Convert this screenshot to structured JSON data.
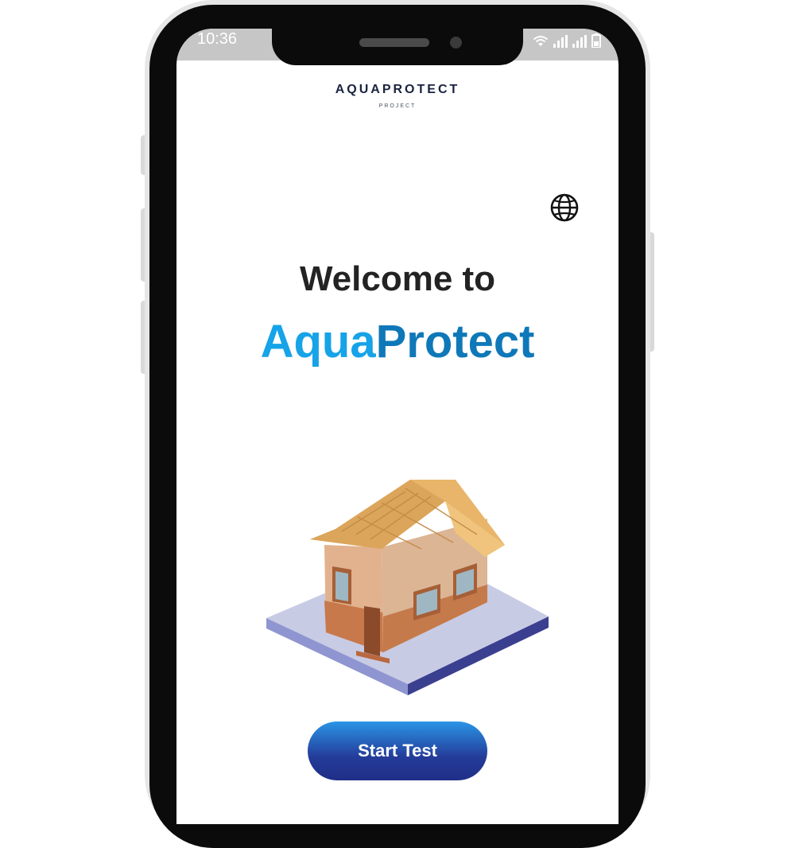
{
  "status_bar": {
    "time": "10:36",
    "icons": [
      "wifi-icon",
      "signal-icon",
      "signal-icon",
      "battery-icon"
    ]
  },
  "header": {
    "logo_title": "AQUAPROTECT",
    "logo_subtitle": "PROJECT"
  },
  "language_button": {
    "icon": "globe-icon"
  },
  "welcome": {
    "line1": "Welcome to",
    "brand_part1": "Aqua",
    "brand_part2": "Protect"
  },
  "illustration": {
    "icon": "house-illustration"
  },
  "start_button": {
    "label": "Start Test"
  },
  "colors": {
    "brand_light": "#16a3e8",
    "brand_dark": "#0f78b8",
    "button_top": "#2a95e6",
    "button_bottom": "#1f2f86",
    "heading": "#232323"
  }
}
